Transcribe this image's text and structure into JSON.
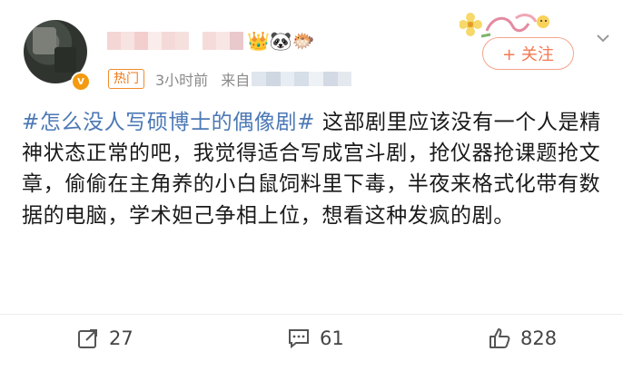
{
  "post": {
    "meta": {
      "hot_tag": "热门",
      "time": "3小时前",
      "source_prefix": "来自"
    },
    "user": {
      "badge_emojis": "👑🐼🐡"
    },
    "follow_label": "+ 关注",
    "content": {
      "topic": "#怎么没人写硕博士的偶像剧#",
      "body": " 这部剧里应该没有一个人是精神状态正常的吧，我觉得适合写成宫斗剧，抢仪器抢课题抢文章，偷偷在主角养的小白鼠饲料里下毒，半夜来格式化带有数据的电脑，学术妲己争相上位，想看这种发疯的剧。"
    },
    "actions": {
      "repost_count": "27",
      "comment_count": "61",
      "like_count": "828"
    },
    "icons": {
      "verified": "verified-badge-icon",
      "more": "chevron-down-icon",
      "repost": "repost-icon",
      "comment": "comment-icon",
      "like": "like-icon"
    },
    "colors": {
      "topic": "#4b78b5",
      "hot_tag": "#f07a1a",
      "follow": "#f27a52"
    }
  }
}
